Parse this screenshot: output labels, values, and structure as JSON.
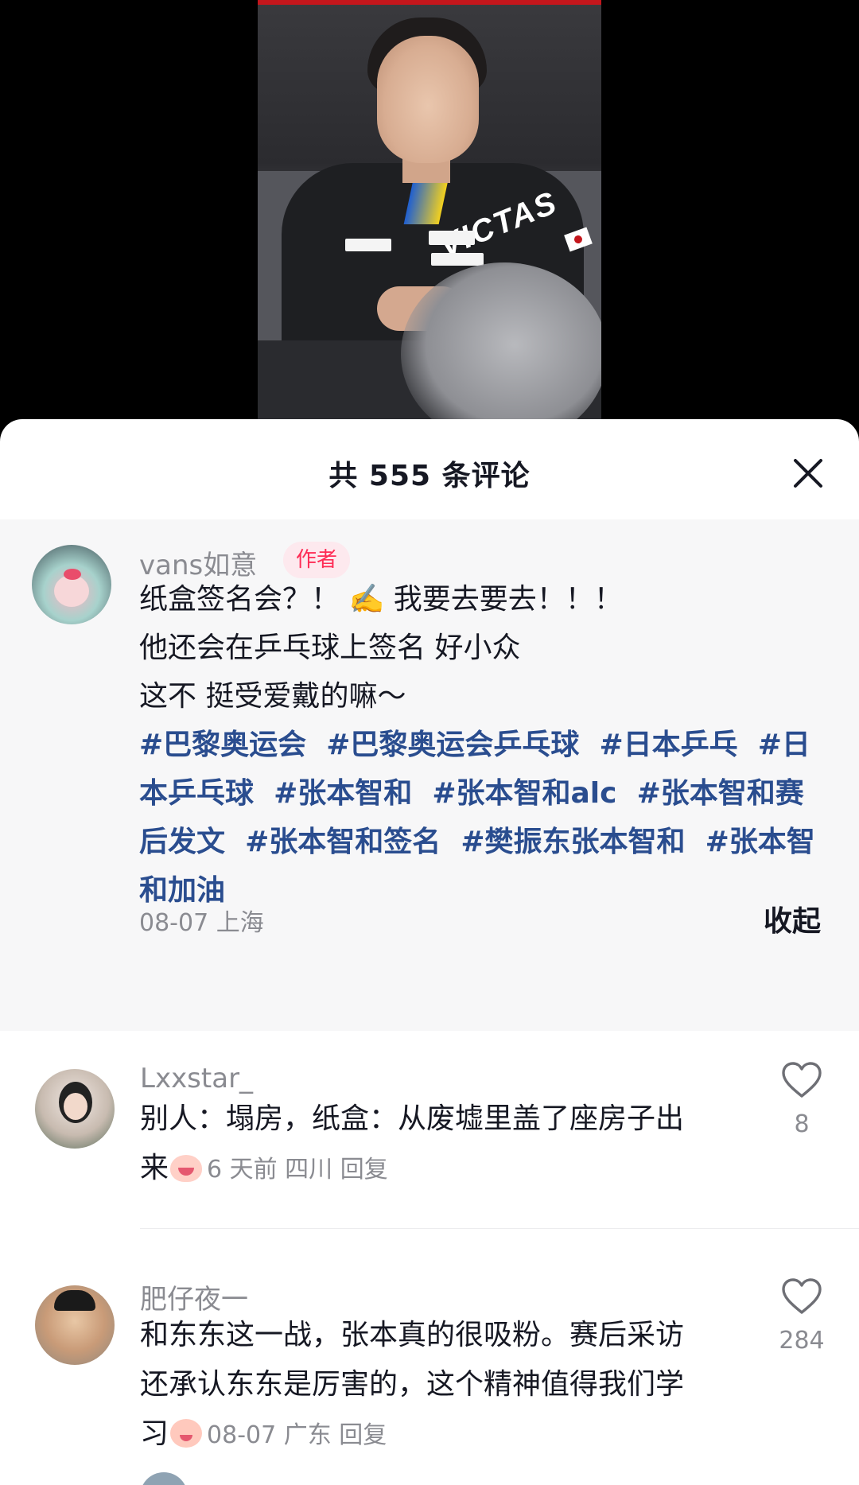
{
  "header": {
    "title": "共 555 条评论"
  },
  "video": {
    "brand": "VICTAS"
  },
  "pinned_comment": {
    "author": "vans如意",
    "badge": "作者",
    "lines": [
      "纸盒签名会？！ ✍️ 我要去要去！！！",
      "他还会在乒乓球上签名 好小众",
      "这不 挺受爱戴的嘛～"
    ],
    "hashtags": [
      "#巴黎奥运会",
      "#巴黎奥运会乒乓球",
      "#日本乒乓",
      "#日本乒乓球",
      "#张本智和",
      "#张本智和alc",
      "#张本智和赛后发文",
      "#张本智和签名",
      "#樊振东张本智和",
      "#张本智和加油"
    ],
    "meta": "08-07 上海",
    "collapse_label": "收起"
  },
  "comments": [
    {
      "user": "Lxxstar_",
      "text": "别人：塌房，纸盒：从废墟里盖了座房子出来",
      "text_line1": "别人：塌房，纸盒：从废墟里盖了座房子出",
      "text_line2": "来",
      "emoji": "cry-emoji",
      "meta": "6 天前 四川",
      "reply_label": "回复",
      "likes": "8"
    },
    {
      "user": "肥仔夜一",
      "text_line1": "和东东这一战，张本真的很吸粉。赛后采访",
      "text_line2": "还承认东东是厉害的，这个精神值得我们学",
      "text_line3": "习",
      "emoji": "blush-emoji",
      "meta": "08-07 广东",
      "reply_label": "回复",
      "likes": "284"
    }
  ],
  "colors": {
    "hashtag": "#2a4d8f",
    "badge_text": "#fe2c55",
    "badge_bg": "#fde9ee",
    "muted": "#8a8b91",
    "pinned_bg": "#f7f7f8"
  }
}
